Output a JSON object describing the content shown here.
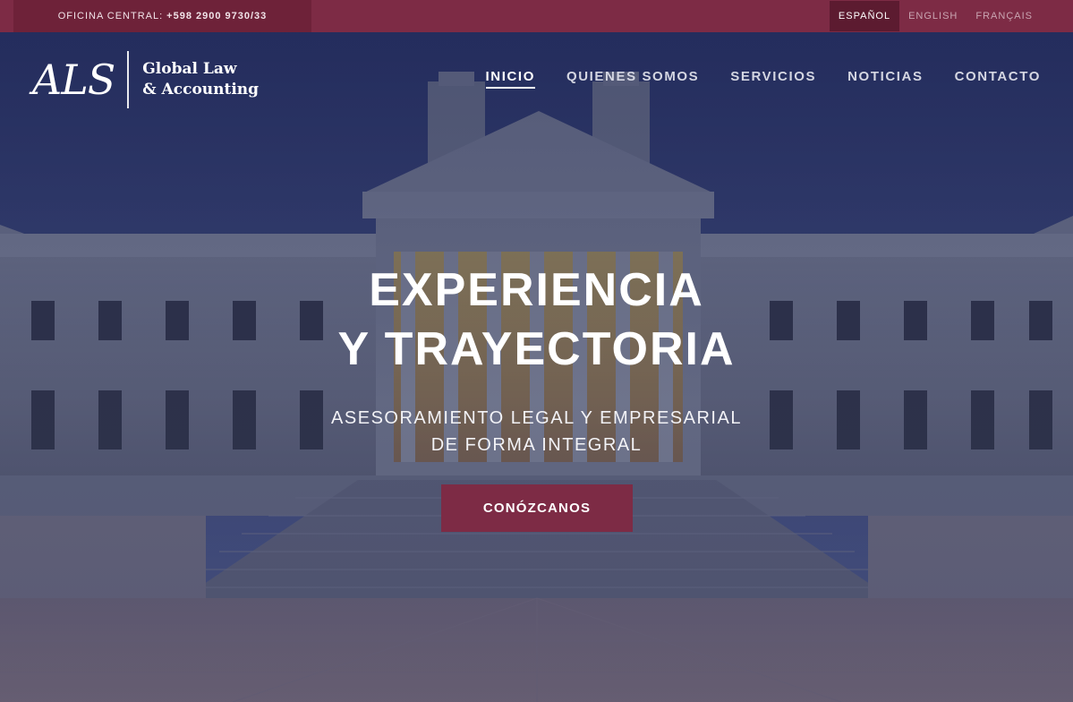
{
  "topbar": {
    "office_label": "OFICINA CENTRAL:",
    "office_phone": "+598 2900 9730/33",
    "languages": [
      "ESPAÑOL",
      "ENGLISH",
      "FRANÇAIS"
    ],
    "active_language": "ESPAÑOL"
  },
  "logo": {
    "mark": "ALS",
    "line1": "Global Law",
    "line2": "& Accounting"
  },
  "nav": {
    "items": [
      "INICIO",
      "QUIENES SOMOS",
      "SERVICIOS",
      "NOTICIAS",
      "CONTACTO"
    ],
    "active": "INICIO"
  },
  "hero": {
    "title_line1": "EXPERIENCIA",
    "title_line2": "Y TRAYECTORIA",
    "subtitle_line1": "ASESORAMIENTO LEGAL Y EMPRESARIAL",
    "subtitle_line2": "DE FORMA INTEGRAL",
    "cta_label": "CONÓZCANOS"
  },
  "colors": {
    "brand": "#7d2b45",
    "brand_dark": "#6e2239",
    "overlay": "#2e3657"
  }
}
